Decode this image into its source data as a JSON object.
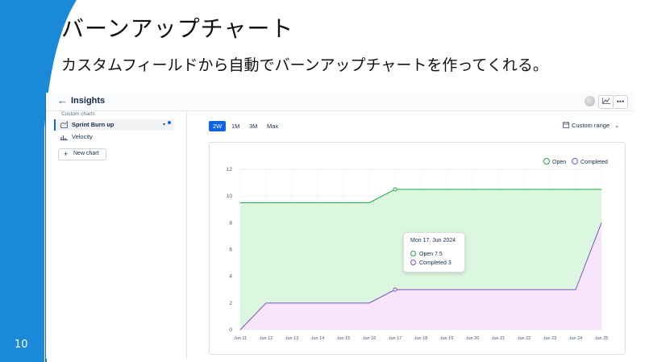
{
  "slide": {
    "title": "バーンアップチャート",
    "subtitle": "カスタムフィールドから自動でバーンアップチャートを作ってくれる。",
    "page_number": "10"
  },
  "app": {
    "title": "Insights",
    "sidebar": {
      "heading": "Custom charts",
      "items": [
        {
          "label": "Sprint Burn up",
          "icon": "area-chart-icon",
          "active": true
        },
        {
          "label": "Velocity",
          "icon": "bar-chart-icon",
          "active": false
        }
      ],
      "new_chart_label": "New chart"
    },
    "ranges": [
      "2W",
      "1M",
      "3M",
      "Max"
    ],
    "active_range": "2W",
    "custom_range_label": "Custom range",
    "tooltip": {
      "title": "Mon 17. Jun 2024",
      "open_label": "Open",
      "open_value": "7.5",
      "completed_label": "Completed",
      "completed_value": "3"
    },
    "colors": {
      "accent": "#0c66e4",
      "open": "#22a846",
      "open_fill": "#dcf7df",
      "completed": "#7b52c7",
      "completed_fill": "#f7e6fb",
      "slide_blue": "#1a8ad8"
    }
  },
  "chart_data": {
    "type": "area",
    "x": [
      "Jun 11",
      "Jun 12",
      "Jun 13",
      "Jun 14",
      "Jun 15",
      "Jun 16",
      "Jun 17",
      "Jun 18",
      "Jun 19",
      "Jun 20",
      "Jun 21",
      "Jun 22",
      "Jun 23",
      "Jun 24",
      "Jun 25"
    ],
    "series": [
      {
        "name": "Open",
        "values": [
          9.5,
          9.5,
          9.5,
          9.5,
          9.5,
          9.5,
          10.5,
          10.5,
          10.5,
          10.5,
          10.5,
          10.5,
          10.5,
          10.5,
          10.5
        ]
      },
      {
        "name": "Completed",
        "values": [
          0,
          2,
          2,
          2,
          2,
          2,
          3,
          3,
          3,
          3,
          3,
          3,
          3,
          3,
          8
        ]
      }
    ],
    "ylim": [
      0,
      12
    ],
    "yticks": [
      0,
      2,
      4,
      6,
      8,
      10,
      12
    ],
    "grid": true,
    "legend": "top-right",
    "highlight_index": 6
  }
}
